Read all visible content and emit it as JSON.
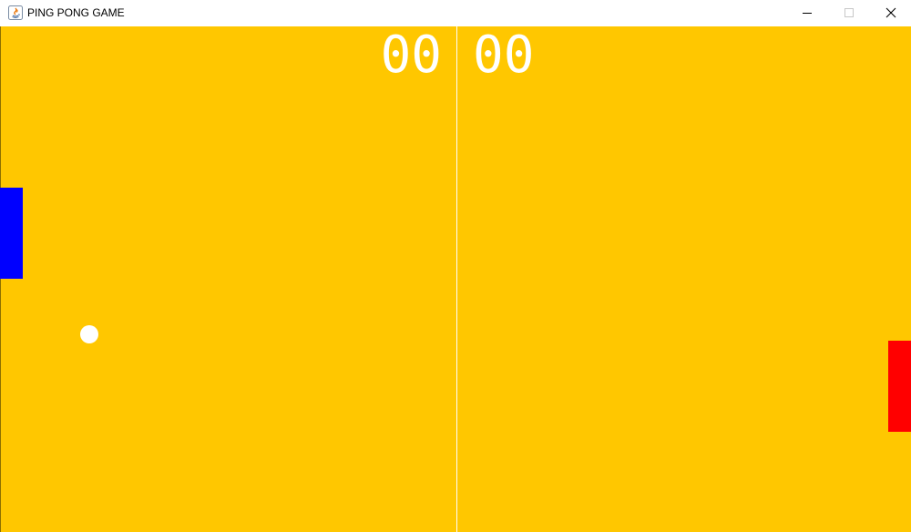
{
  "window": {
    "title": "PING PONG GAME",
    "app_icon": "java-icon",
    "controls": {
      "minimize_icon": "minimize-icon",
      "maximize_icon": "maximize-icon",
      "close_icon": "close-icon"
    }
  },
  "game": {
    "background_color": "#ffc700",
    "center_line_color": "#ffffff",
    "score_color": "#ffffff",
    "score_left": "00",
    "score_right": "00",
    "left_paddle_color": "#0000ff",
    "right_paddle_color": "#ff0000",
    "ball_color": "#ffffff"
  }
}
